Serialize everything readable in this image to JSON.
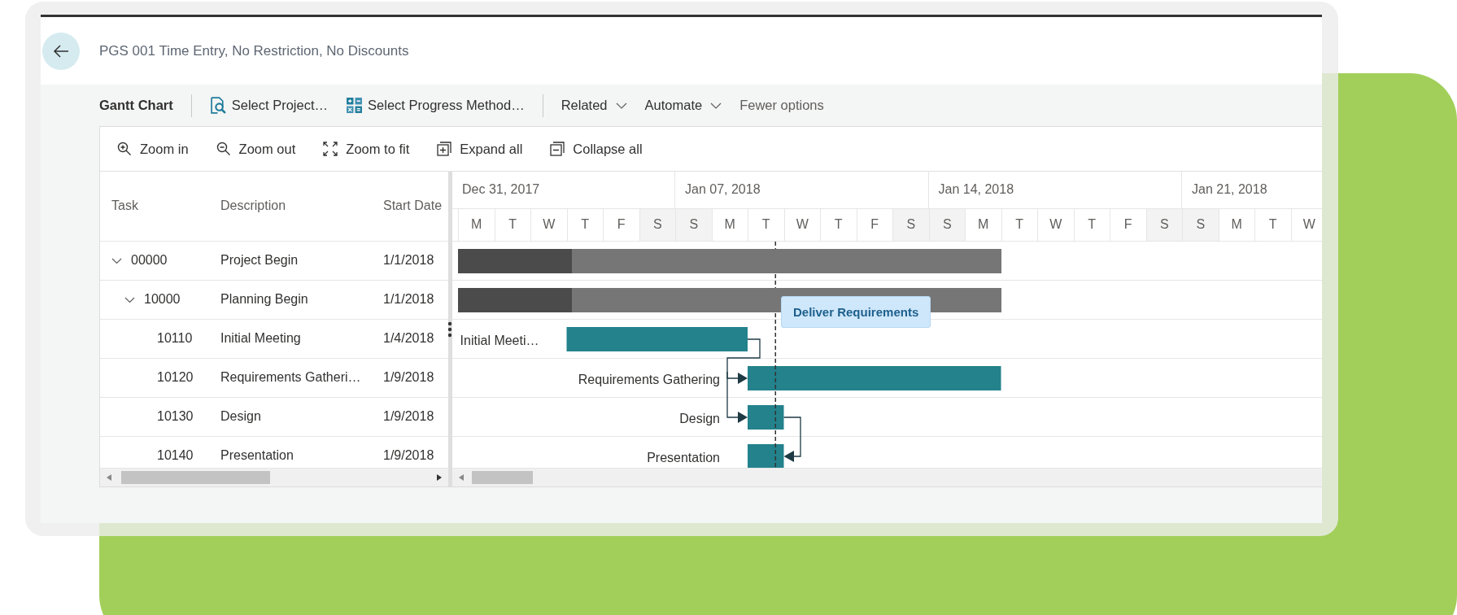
{
  "page": {
    "title": "PGS 001 Time Entry, No Restriction, No Discounts"
  },
  "command_bar": {
    "title": "Gantt Chart",
    "actions": [
      {
        "label": "Select Project…",
        "kind": "action"
      },
      {
        "label": "Select Progress Method…",
        "kind": "action"
      },
      {
        "label": "Related",
        "kind": "menu"
      },
      {
        "label": "Automate",
        "kind": "menu"
      },
      {
        "label": "Fewer options",
        "kind": "link"
      }
    ]
  },
  "gantt": {
    "toolbar": [
      "Zoom in",
      "Zoom out",
      "Zoom to fit",
      "Expand all",
      "Collapse all"
    ],
    "columns": [
      "Task",
      "Description",
      "Start Date"
    ],
    "tasks": [
      {
        "task": "00000",
        "description": "Project Begin",
        "start_date": "1/1/2018",
        "kind": "summary",
        "level": 0.21,
        "expanded": true,
        "children": [
          {
            "task": "10000",
            "description": "Planning Begin",
            "start_date": "1/1/2018",
            "kind": "summary",
            "level": 0.21,
            "expanded": true,
            "children": [
              {
                "task": "10110",
                "description": "Initial Meeting",
                "start_date": "1/4/2018",
                "kind": "task",
                "bar_label": "Initial Meeti…"
              },
              {
                "task": "10120",
                "description": "Requirements Gatheri…",
                "start_date": "1/9/2018",
                "kind": "task",
                "bar_label": "Requirements Gathering"
              },
              {
                "task": "10130",
                "description": "Design",
                "start_date": "1/9/2018",
                "kind": "task",
                "bar_label": "Design"
              },
              {
                "task": "10140",
                "description": "Presentation",
                "start_date": "1/9/2018",
                "kind": "task",
                "bar_label": "Presentation"
              }
            ]
          }
        ]
      }
    ],
    "weeks": [
      "Dec 31, 2017",
      "Jan 07, 2018",
      "Jan 14, 2018",
      "Jan 21, 2018"
    ],
    "days": [
      {
        "label": "M",
        "weekend": false
      },
      {
        "label": "T",
        "weekend": false
      },
      {
        "label": "W",
        "weekend": false
      },
      {
        "label": "T",
        "weekend": false
      },
      {
        "label": "F",
        "weekend": false
      },
      {
        "label": "S",
        "weekend": true
      },
      {
        "label": "S",
        "weekend": true
      },
      {
        "label": "M",
        "weekend": false
      },
      {
        "label": "T",
        "weekend": false
      },
      {
        "label": "W",
        "weekend": false
      },
      {
        "label": "T",
        "weekend": false
      },
      {
        "label": "F",
        "weekend": false
      },
      {
        "label": "S",
        "weekend": true
      },
      {
        "label": "S",
        "weekend": true
      },
      {
        "label": "M",
        "weekend": false
      },
      {
        "label": "T",
        "weekend": false
      },
      {
        "label": "W",
        "weekend": false
      },
      {
        "label": "T",
        "weekend": false
      },
      {
        "label": "F",
        "weekend": false
      },
      {
        "label": "S",
        "weekend": true
      },
      {
        "label": "S",
        "weekend": true
      },
      {
        "label": "M",
        "weekend": false
      },
      {
        "label": "T",
        "weekend": false
      },
      {
        "label": "W",
        "weekend": false
      }
    ],
    "tooltip": "Deliver Requirements"
  }
}
